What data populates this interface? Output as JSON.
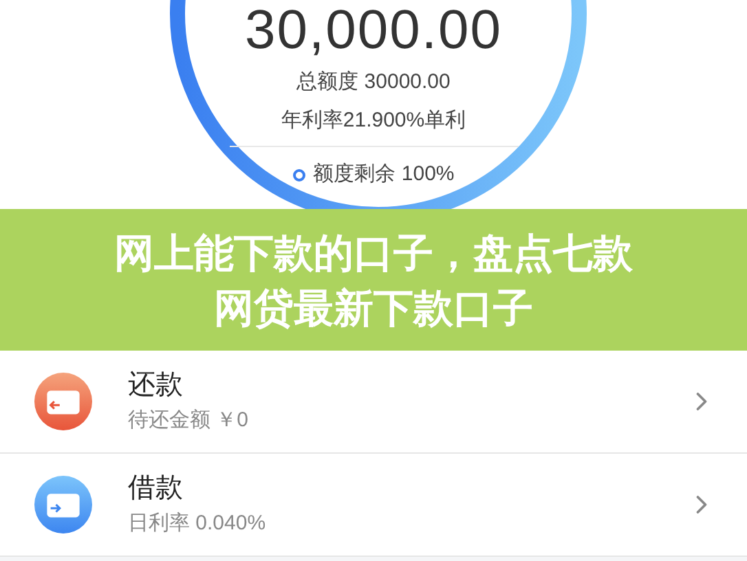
{
  "gauge": {
    "amount": "30,000.00",
    "total": "总额度 30000.00",
    "rate": "年利率21.900%单利",
    "remaining": "额度剩余 100%"
  },
  "banner": {
    "title_lines": [
      "网上能下款的口子，盘点七款",
      "网贷最新下款口子"
    ]
  },
  "items": [
    {
      "kind": "repay",
      "title": "还款",
      "subtitle": "待还金额 ￥0"
    },
    {
      "kind": "borrow",
      "title": "借款",
      "subtitle": "日利率 0.040%"
    }
  ]
}
